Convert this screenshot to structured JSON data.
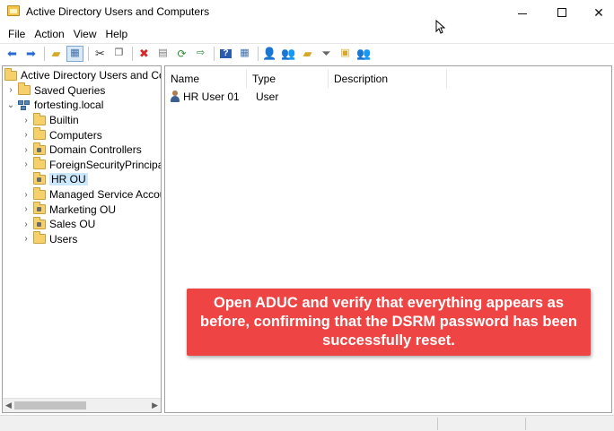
{
  "window": {
    "title": "Active Directory Users and Computers",
    "minimize_icon": "minimize-icon",
    "maximize_icon": "maximize-icon",
    "close_icon": "close-icon"
  },
  "menu": [
    "File",
    "Action",
    "View",
    "Help"
  ],
  "toolbar": {
    "buttons": [
      "back",
      "forward",
      "up-folder",
      "show-hide-console-tree",
      "cut",
      "copy",
      "delete",
      "properties",
      "refresh",
      "export-list",
      "help",
      "show-hide-action-pane",
      "new-user",
      "new-group",
      "new-ou",
      "filter",
      "find",
      "add-to-group"
    ]
  },
  "tree": {
    "root": "Active Directory Users and Com",
    "saved_queries": "Saved Queries",
    "domain": "fortesting.local",
    "children": [
      "Builtin",
      "Computers",
      "Domain Controllers",
      "ForeignSecurityPrincipals",
      "HR OU",
      "Managed Service Accour",
      "Marketing OU",
      "Sales OU",
      "Users"
    ],
    "selected": "HR OU"
  },
  "list": {
    "columns": [
      "Name",
      "Type",
      "Description"
    ],
    "rows": [
      {
        "name": "HR User 01",
        "type": "User",
        "description": ""
      }
    ]
  },
  "callout": {
    "text": "Open ADUC and verify that everything appears as before, confirming that the DSRM password has been successfully reset.",
    "color": "#ee4444"
  }
}
